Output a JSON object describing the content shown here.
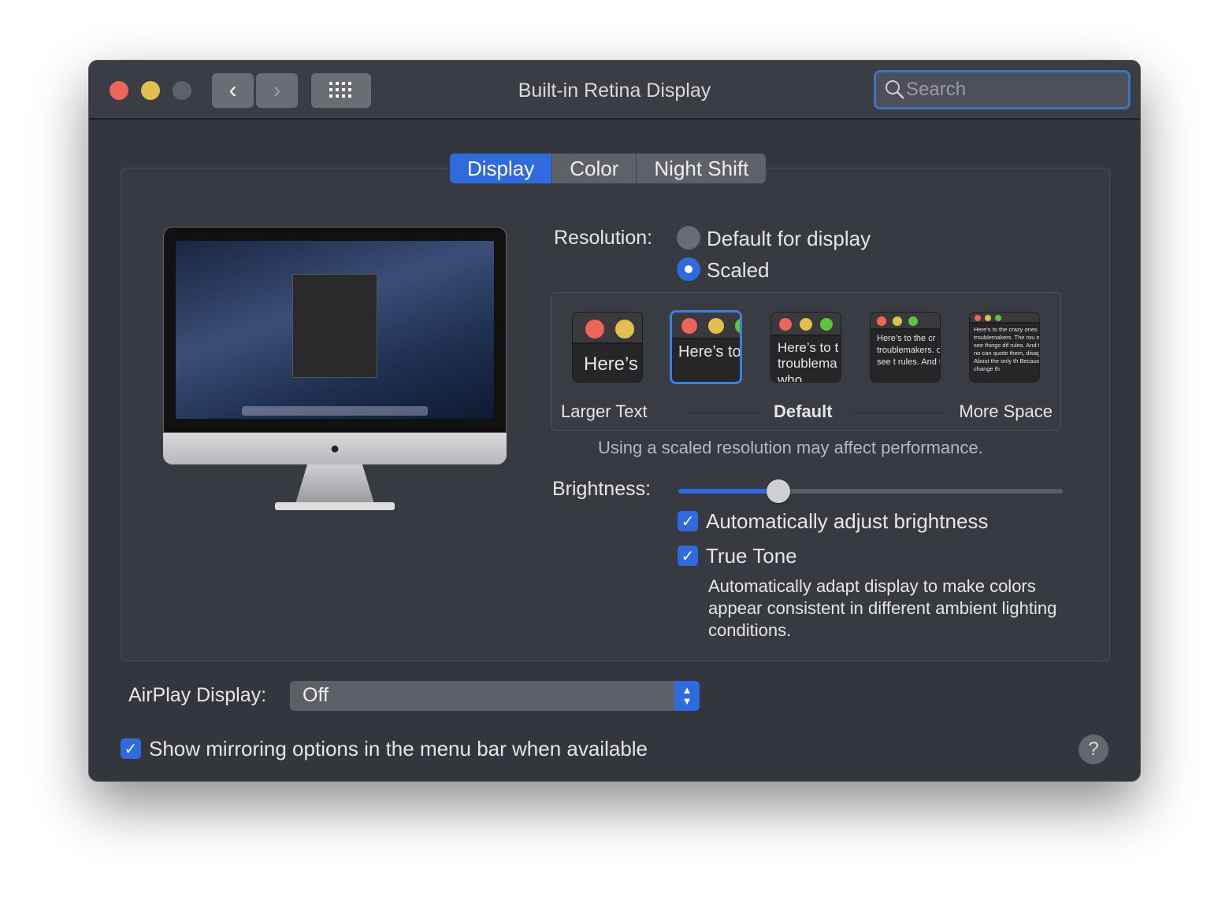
{
  "window": {
    "title": "Built-in Retina Display",
    "search_placeholder": "Search"
  },
  "tabs": [
    {
      "label": "Display",
      "selected": true
    },
    {
      "label": "Color",
      "selected": false
    },
    {
      "label": "Night Shift",
      "selected": false
    }
  ],
  "resolution": {
    "label": "Resolution:",
    "options": [
      {
        "label": "Default for display",
        "selected": false
      },
      {
        "label": "Scaled",
        "selected": true
      }
    ],
    "scale_labels": {
      "left": "Larger Text",
      "middle": "Default",
      "right": "More Space"
    },
    "thumb_text": [
      "Here’s",
      "Here’s to troublem",
      "Here’s to t troublema ones who",
      "Here’s to the cr troublemakers. ones who see t rules. And they",
      "Here’s to the crazy ones troublemakers. The rou ones who see things dif rules. And they have no can quote them, disagre them. About the only th Because they change th"
    ],
    "selected_index": 1,
    "note": "Using a scaled resolution may affect performance."
  },
  "brightness": {
    "label": "Brightness:",
    "value": 0.26,
    "auto_label": "Automatically adjust brightness",
    "auto_checked": true
  },
  "true_tone": {
    "label": "True Tone",
    "checked": true,
    "description": "Automatically adapt display to make colors appear consistent in different ambient lighting conditions."
  },
  "airplay": {
    "label": "AirPlay Display:",
    "value": "Off"
  },
  "mirroring": {
    "label": "Show mirroring options in the menu bar when available",
    "checked": true
  },
  "help": "?",
  "colors": {
    "accent": "#2f6bdc",
    "close": "#ec6559",
    "minimize": "#e1c04c",
    "zoom": "#5ec440"
  }
}
